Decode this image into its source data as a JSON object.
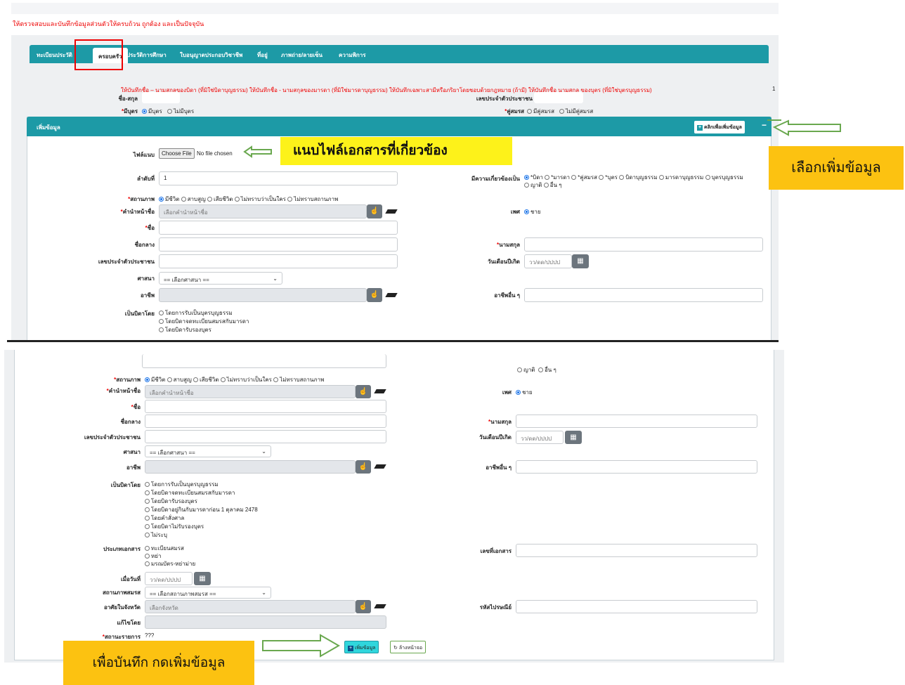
{
  "notice": "ให้ตรวจสอบและบันทึกข้อมูลส่วนตัวให้ครบถ้วน ถูกต้อง และเป็นปัจจุบัน",
  "tabs": [
    "ทะเบียนประวัติ",
    "ครอบครัว",
    "ประวัติการศึกษา",
    "ใบอนุญาตประกอบวิชาชีพ",
    "ที่อยู่",
    "ภาพถ่าย/ลายเซ็น",
    "ความพิการ"
  ],
  "instruction": "ให้บันทึกชื่อ – นามสกุลของบิดา (ที่มิใช่บิดาบุญธรรม) ให้บันทึกชื่อ - นามสกุลของมารดา (ที่มิใช่มารดาบุญธรรม) ให้บันทึกเฉพาะสามีหรือภริยาโดยชอบด้วยกฎหมาย (ถ้ามี) ให้บันทึกชื่อ นามสกุล ของบุตร (ที่มิใช่บุตรบุญธรรม)",
  "side_number": "1",
  "labels": {
    "fullname": "ชื่อ-สกุล",
    "id_card": "เลขประจำตัวประชาชน",
    "has_child": "มีบุตร",
    "spouse": "คู่สมรส",
    "attach": "ไฟล์แนบ",
    "order": "ลำดับที่",
    "relation": "มีความเกี่ยวข้องเป็น",
    "status": "สถานภาพ",
    "prefix": "คำนำหน้าชื่อ",
    "gender": "เพศ",
    "first_name": "ชื่อ",
    "middle_name": "ชื่อกลาง",
    "last_name": "นามสกุล",
    "citizen_id": "เลขประจำตัวประชาชน",
    "birth_date": "วันเดือนปีเกิด",
    "religion": "ศาสนา",
    "occupation": "อาชีพ",
    "other_occupation": "อาชีพอื่น ๆ",
    "father_by": "เป็นบิดาโดย",
    "doc_type": "ประเภทเอกสาร",
    "doc_no": "เลขที่เอกสาร",
    "on_date": "เมื่อวันที่",
    "marital_status": "สถานภาพสมรส",
    "province": "อาศัยในจังหวัด",
    "postcode": "รหัสไปรษณีย์",
    "edited_by": "แก้ไขโดย",
    "record_status": "สถานะรายการ"
  },
  "options": {
    "child": [
      "มีบุตร",
      "ไม่มีบุตร"
    ],
    "spouse": [
      "มีคู่สมรส",
      "ไม่มีคู่สมรส"
    ],
    "relation": [
      "*บิดา",
      "*มารดา",
      "*คู่สมรส",
      "*บุตร",
      "บิดาบุญธรรม",
      "มารดาบุญธรรม",
      "บุตรบุญธรรม"
    ],
    "relation2": [
      "ญาติ",
      "อื่น ๆ"
    ],
    "status": [
      "มีชีวิต",
      "สาบสูญ",
      "เสียชีวิต",
      "ไม่ทราบว่าเป็นใคร",
      "ไม่ทราบสถานภาพ"
    ],
    "gender": "ชาย",
    "father_by": [
      "โดยการรับเป็นบุตรบุญธรรม",
      "โดยบิดาจดทะเบียนสมรสกับมารดา",
      "โดยบิดารับรองบุตร",
      "โดยบิดาอยู่กินกับมารดาก่อน 1 ตุลาคม 2478",
      "โดยคำสั่งศาล",
      "โดยบิดาไม่รับรองบุตร",
      "ไม่ระบุ"
    ],
    "father_by_top": [
      "โดยการรับเป็นบุตรบุญธรรม",
      "โดยบิดาจดทะเบียนสมรสกับมารดา",
      "โดยบิดารับรองบุตร"
    ],
    "doc_type": [
      "ทะเบียนสมรส",
      "หย่า",
      "มรณบัตร-หย่าม่าย"
    ]
  },
  "values": {
    "order": "1",
    "prefix_ph": "เลือกคำนำหน้าชื่อ",
    "date_ph": "วว/ดด/ปปปป",
    "religion": "== เลือกศาสนา ==",
    "marital": "== เลือกสถานภาพสมรส ==",
    "province_ph": "เลือกจังหวัด",
    "record_status": "???",
    "file_btn": "Choose File",
    "file_text": "No file chosen"
  },
  "section_title": "เพิ่มข้อมูล",
  "add_link": "คลิกเพื่อเพิ่มข้อมูล",
  "minus": "−",
  "submit_btn": "เพิ่มข้อมูล",
  "clear_btn": "ล้างหน้าจอ",
  "notes": {
    "attach": "แนบไฟล์เอกสารที่เกี่ยวข้อง",
    "add": "เลือกเพิ่มข้อมูล",
    "save": "เพื่อบันทึก กดเพิ่มข้อมูล"
  },
  "colors": {
    "teal": "#1d9aa6",
    "red": "#e00000",
    "yellow": "#fdf21a",
    "orange": "#fcc211",
    "green_arrow": "#6aa84f"
  },
  "icons": {
    "calendar": "calendar-icon",
    "plus": "plus-square-icon",
    "refresh": "refresh-icon",
    "hand": "pointer-hand-icon",
    "eraser": "eraser-icon",
    "arrow": "left-arrow-icon"
  }
}
